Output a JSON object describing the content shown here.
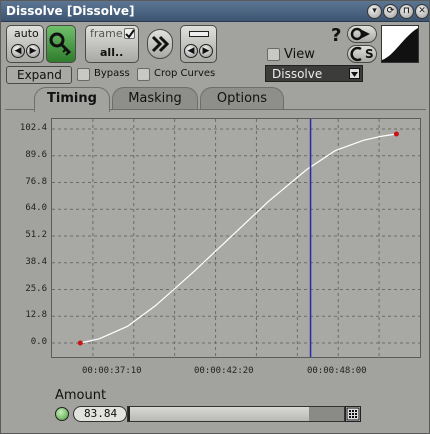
{
  "window": {
    "title": "Dissolve [Dissolve]",
    "buttons": [
      {
        "name": "minimize",
        "glyph": "▾"
      },
      {
        "name": "refresh",
        "glyph": "⟳"
      },
      {
        "name": "lock",
        "glyph": "⊓"
      },
      {
        "name": "close",
        "glyph": "✕"
      }
    ]
  },
  "toolbar": {
    "auto_label": "auto",
    "frame_label": "frame",
    "all_label": "all..",
    "view_label": "View",
    "help_glyph": "?",
    "s_label": "S",
    "expand_label": "Expand",
    "bypass_label": "Bypass",
    "crop_curves_label": "Crop Curves",
    "effect_select": "Dissolve"
  },
  "tabs": [
    {
      "label": "Timing",
      "active": true
    },
    {
      "label": "Masking",
      "active": false
    },
    {
      "label": "Options",
      "active": false
    }
  ],
  "colors": {
    "curve": "#ffffff",
    "playhead": "#2828b0",
    "keyframe": "#c81414",
    "grid": "#6c6c6a"
  },
  "chart_data": {
    "type": "line",
    "title": "",
    "xlabel": "",
    "ylabel": "",
    "yticks": [
      "0.0",
      "12.8",
      "25.6",
      "38.4",
      "51.2",
      "64.0",
      "76.8",
      "89.6",
      "102.4"
    ],
    "xticks": [
      "00:00:37:10",
      "00:00:42:20",
      "00:00:48:00"
    ],
    "ylim": [
      0,
      102.4
    ],
    "series": [
      {
        "points": [
          [
            0,
            0
          ],
          [
            2,
            2
          ],
          [
            5,
            8
          ],
          [
            8,
            18
          ],
          [
            12,
            34
          ],
          [
            16,
            51
          ],
          [
            20,
            68
          ],
          [
            24,
            83
          ],
          [
            27,
            92
          ],
          [
            30,
            97
          ],
          [
            32,
            99
          ],
          [
            33.5,
            100
          ]
        ]
      }
    ],
    "keyframes": [
      [
        0,
        0
      ],
      [
        33.5,
        100
      ]
    ],
    "playhead_x": 24.4,
    "x_domain": [
      -3,
      36
    ],
    "grid": true
  },
  "amount": {
    "label": "Amount",
    "value": "83.84",
    "fraction": 0.8384
  }
}
